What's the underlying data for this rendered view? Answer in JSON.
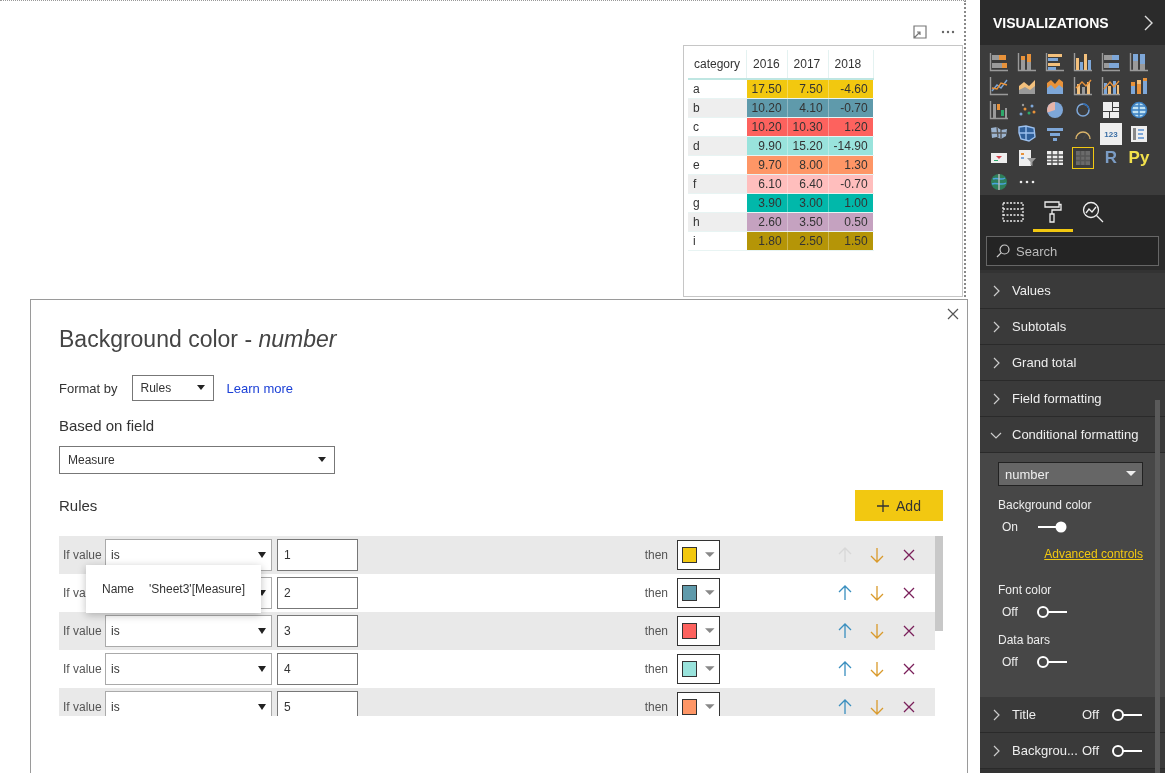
{
  "table": {
    "columns": [
      "category",
      "2016",
      "2017",
      "2018"
    ],
    "rows": [
      {
        "category": "a",
        "values": [
          "17.50",
          "7.50",
          "-4.60"
        ],
        "color": "#f2c80f"
      },
      {
        "category": "b",
        "values": [
          "10.20",
          "4.10",
          "-0.70"
        ],
        "color": "#5f9aab"
      },
      {
        "category": "c",
        "values": [
          "10.20",
          "10.30",
          "1.20"
        ],
        "color": "#fd625e"
      },
      {
        "category": "d",
        "values": [
          "9.90",
          "15.20",
          "-14.90"
        ],
        "color": "#99e3dc"
      },
      {
        "category": "e",
        "values": [
          "9.70",
          "8.00",
          "1.30"
        ],
        "color": "#fe9666"
      },
      {
        "category": "f",
        "values": [
          "6.10",
          "6.40",
          "-0.70"
        ],
        "color": "#ffbebd"
      },
      {
        "category": "g",
        "values": [
          "3.90",
          "3.00",
          "1.00"
        ],
        "color": "#01b8aa"
      },
      {
        "category": "h",
        "values": [
          "2.60",
          "3.50",
          "0.50"
        ],
        "color": "#c5a2c0"
      },
      {
        "category": "i",
        "values": [
          "1.80",
          "2.50",
          "1.50"
        ],
        "color": "#b59507"
      }
    ]
  },
  "dialog": {
    "title": "Background color - *number*",
    "format_by": {
      "label": "Format by",
      "value": "Rules"
    },
    "learn_more": "Learn more",
    "based_on_field": {
      "label": "Based on field",
      "value": "Measure"
    },
    "rules_heading": "Rules",
    "add_button": "Add",
    "rules": [
      {
        "label": "If value",
        "operator": "is",
        "value": "1",
        "then": "then",
        "color": "#f2c80f",
        "up_disabled": true
      },
      {
        "label": "If va",
        "value": "2",
        "then": "then",
        "color": "#5f9aab",
        "up_disabled": false
      },
      {
        "label": "If value",
        "operator": "is",
        "value": "3",
        "then": "then",
        "color": "#fd625e",
        "up_disabled": false
      },
      {
        "label": "If value",
        "operator": "is",
        "value": "4",
        "then": "then",
        "color": "#99e3dc",
        "up_disabled": false
      },
      {
        "label": "If value",
        "operator": "is",
        "value": "5",
        "then": "then",
        "color": "#fe9666",
        "up_disabled": false
      }
    ],
    "tooltip": {
      "label": "Name",
      "value": "'Sheet3'[Measure]"
    }
  },
  "panel": {
    "title": "VISUALIZATIONS",
    "visuals": [
      {
        "kind": "stacked-bar",
        "selected": false
      },
      {
        "kind": "stacked-column",
        "selected": false
      },
      {
        "kind": "clustered-bar",
        "selected": false
      },
      {
        "kind": "clustered-column",
        "selected": false
      },
      {
        "kind": "full-bar",
        "selected": false
      },
      {
        "kind": "full-column",
        "selected": false
      },
      {
        "kind": "line",
        "selected": false
      },
      {
        "kind": "area",
        "selected": false
      },
      {
        "kind": "stacked-area",
        "selected": false
      },
      {
        "kind": "line-column",
        "selected": false
      },
      {
        "kind": "line-clustered",
        "selected": false
      },
      {
        "kind": "ribbon",
        "selected": false
      },
      {
        "kind": "waterfall",
        "selected": false
      },
      {
        "kind": "scatter",
        "selected": false
      },
      {
        "kind": "pie",
        "selected": false
      },
      {
        "kind": "donut",
        "selected": false
      },
      {
        "kind": "treemap",
        "selected": false
      },
      {
        "kind": "globe",
        "selected": false
      },
      {
        "kind": "filled-map",
        "selected": false
      },
      {
        "kind": "shape-map",
        "selected": false
      },
      {
        "kind": "funnel",
        "selected": false
      },
      {
        "kind": "gauge",
        "selected": false
      },
      {
        "kind": "card",
        "label": "123",
        "selected": false
      },
      {
        "kind": "multi-card",
        "selected": false
      },
      {
        "kind": "kpi",
        "selected": false
      },
      {
        "kind": "slicer",
        "selected": false
      },
      {
        "kind": "table",
        "selected": false
      },
      {
        "kind": "matrix",
        "selected": true
      },
      {
        "kind": "script",
        "label": "R",
        "color": "#7b9cc4",
        "selected": false
      },
      {
        "kind": "script",
        "label": "Py",
        "color": "#f2e14c",
        "selected": false
      },
      {
        "kind": "earth",
        "selected": false
      },
      {
        "kind": "more",
        "selected": false
      }
    ],
    "pane_tabs": [
      {
        "kind": "fields",
        "selected": false
      },
      {
        "kind": "format",
        "selected": true
      },
      {
        "kind": "analytics",
        "selected": false
      }
    ],
    "search": {
      "placeholder": "Search"
    },
    "sections": [
      {
        "label": "Values",
        "expanded": false
      },
      {
        "label": "Subtotals",
        "expanded": false
      },
      {
        "label": "Grand total",
        "expanded": false
      },
      {
        "label": "Field formatting",
        "expanded": false
      },
      {
        "label": "Conditional formatting",
        "expanded": true,
        "content": {
          "field": "number",
          "settings": [
            {
              "label": "Background color",
              "on": true,
              "state": "On",
              "link": "Advanced controls"
            },
            {
              "label": "Font color",
              "on": false,
              "state": "Off"
            },
            {
              "label": "Data bars",
              "on": false,
              "state": "Off"
            }
          ]
        }
      },
      {
        "label": "Title",
        "expanded": false,
        "toggle": {
          "on": false,
          "state": "Off"
        }
      },
      {
        "label": "Backgrou...",
        "expanded": false,
        "toggle": {
          "on": false,
          "state": "Off"
        }
      }
    ]
  }
}
